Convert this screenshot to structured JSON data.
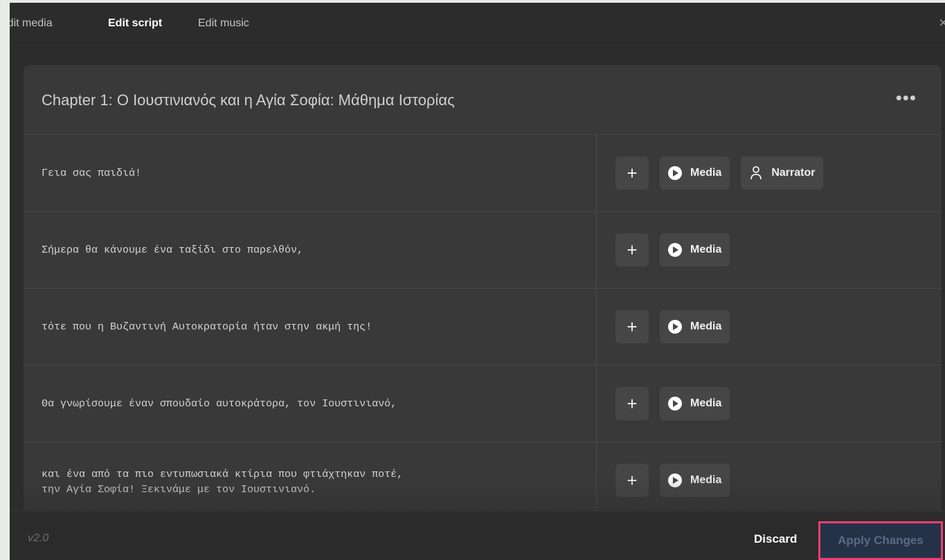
{
  "tabs": [
    {
      "label": "Edit media",
      "active": false
    },
    {
      "label": "Edit script",
      "active": true
    },
    {
      "label": "Edit music",
      "active": false
    }
  ],
  "chapter": {
    "title": "Chapter 1: Ο Ιουστινιανός και η Αγία Σοφία: Μάθημα Ιστορίας",
    "more_icon": "ellipsis-icon"
  },
  "rows": [
    {
      "text": "Γεια σας παιδιά!",
      "add_label": "+",
      "media_label": "Media",
      "narrator_label": "Narrator"
    },
    {
      "text": "Σήμερα θα κάνουμε ένα ταξίδι στο παρελθόν,",
      "add_label": "+",
      "media_label": "Media"
    },
    {
      "text": "τότε που η Βυζαντινή Αυτοκρατορία ήταν στην ακμή της!",
      "add_label": "+",
      "media_label": "Media"
    },
    {
      "text": "Θα γνωρίσουμε έναν σπουδαίο αυτοκράτορα, τον Ιουστινιανό,",
      "add_label": "+",
      "media_label": "Media"
    },
    {
      "text": "και ένα από τα πιο εντυπωσιακά κτίρια που φτιάχτηκαν ποτέ,\nτην Αγία Σοφία! Ξεκινάμε με τον Ιουστινιανό.",
      "add_label": "+",
      "media_label": "Media"
    }
  ],
  "footer": {
    "version": "v2.0",
    "discard_label": "Discard",
    "apply_label": "Apply Changes"
  },
  "colors": {
    "highlight_border": "#ee3f70",
    "apply_bg": "#243248"
  },
  "close_icon": "×"
}
